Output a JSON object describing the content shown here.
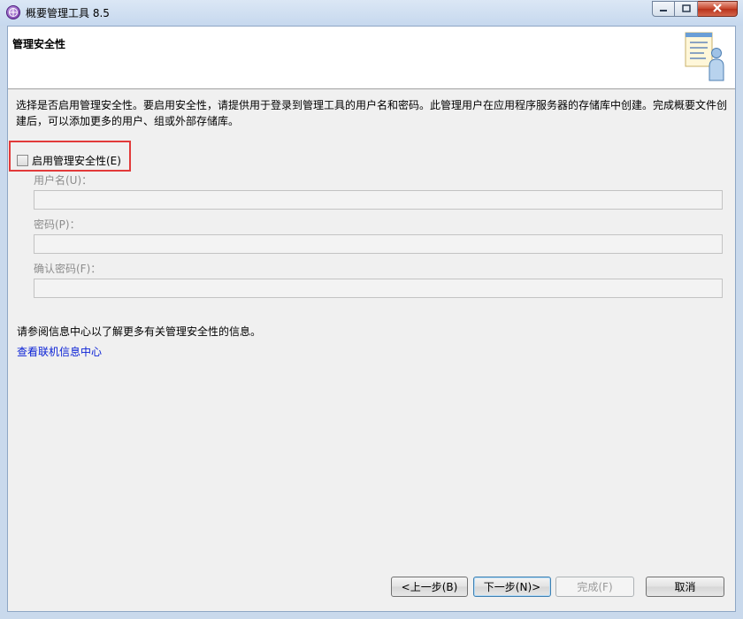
{
  "window": {
    "title": "概要管理工具 8.5",
    "icon": "app-globe-icon",
    "controls": [
      "minimize-icon",
      "maximize-icon",
      "close-icon"
    ]
  },
  "header": {
    "title": "管理安全性",
    "icon": "wizard-user-icon"
  },
  "description": "选择是否启用管理安全性。要启用安全性，请提供用于登录到管理工具的用户名和密码。此管理用户在应用程序服务器的存储库中创建。完成概要文件创建后，可以添加更多的用户、组或外部存储库。",
  "security": {
    "enable_label": "启用管理安全性(E)",
    "enabled": false,
    "username_label": "用户名(U)：",
    "username_value": "",
    "password_label": "密码(P)：",
    "password_value": "",
    "confirm_label": "确认密码(F)：",
    "confirm_value": ""
  },
  "info": {
    "text": "请参阅信息中心以了解更多有关管理安全性的信息。",
    "link": "查看联机信息中心"
  },
  "buttons": {
    "back": "<上一步(B)",
    "next": "下一步(N)>",
    "finish": "完成(F)",
    "cancel": "取消"
  },
  "colors": {
    "highlight_border": "#e23a3a",
    "link": "#0b22d6"
  }
}
